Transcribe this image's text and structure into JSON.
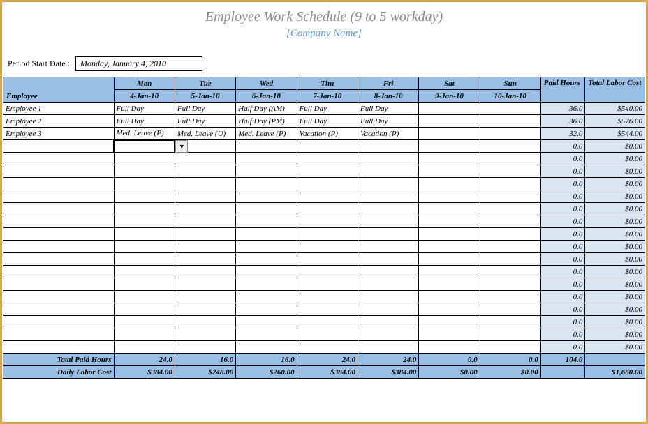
{
  "title": "Employee Work Schedule (9 to 5  workday)",
  "subtitle": "[Company Name]",
  "start_label": "Period Start Date :",
  "start_value": "Monday, January 4, 2010",
  "headers": {
    "employee": "Employee",
    "days": [
      {
        "day": "Mon",
        "date": "4-Jan-10"
      },
      {
        "day": "Tue",
        "date": "5-Jan-10"
      },
      {
        "day": "Wed",
        "date": "6-Jan-10"
      },
      {
        "day": "Thu",
        "date": "7-Jan-10"
      },
      {
        "day": "Fri",
        "date": "8-Jan-10"
      },
      {
        "day": "Sat",
        "date": "9-Jan-10"
      },
      {
        "day": "Sun",
        "date": "10-Jan-10"
      }
    ],
    "paid_hours": "Paid Hours",
    "labor_cost": "Total Labor Cost"
  },
  "rows": [
    {
      "emp": "Employee 1",
      "cells": [
        {
          "t": "Full Day",
          "c": "full-day"
        },
        {
          "t": "Full Day",
          "c": "full-day"
        },
        {
          "t": "Half Day (AM)",
          "c": "half-am"
        },
        {
          "t": "Full Day",
          "c": "full-day"
        },
        {
          "t": "Full Day",
          "c": "full-day"
        },
        {
          "t": "",
          "c": ""
        },
        {
          "t": "",
          "c": ""
        }
      ],
      "hours": "36.0",
      "cost": "$540.00"
    },
    {
      "emp": "Employee 2",
      "cells": [
        {
          "t": "Full Day",
          "c": "full-day"
        },
        {
          "t": "Full Day",
          "c": "full-day"
        },
        {
          "t": "Half Day (PM)",
          "c": "half-pm"
        },
        {
          "t": "Full Day",
          "c": "full-day"
        },
        {
          "t": "Full Day",
          "c": "full-day"
        },
        {
          "t": "",
          "c": ""
        },
        {
          "t": "",
          "c": ""
        }
      ],
      "hours": "36.0",
      "cost": "$576.00"
    },
    {
      "emp": "Employee 3",
      "cells": [
        {
          "t": "Med. Leave (P)",
          "c": "med-p"
        },
        {
          "t": "Med. Leave (U)",
          "c": "med-u"
        },
        {
          "t": "Med. Leave (P)",
          "c": "med-p"
        },
        {
          "t": "Vacation (P)",
          "c": "vac"
        },
        {
          "t": "Vacation (P)",
          "c": "vac"
        },
        {
          "t": "",
          "c": ""
        },
        {
          "t": "",
          "c": ""
        }
      ],
      "hours": "32.0",
      "cost": "$544.00"
    },
    {
      "emp": "",
      "cells": [
        {
          "t": "",
          "c": "",
          "active": true
        },
        {
          "t": "",
          "c": ""
        },
        {
          "t": "",
          "c": ""
        },
        {
          "t": "",
          "c": ""
        },
        {
          "t": "",
          "c": ""
        },
        {
          "t": "",
          "c": ""
        },
        {
          "t": "",
          "c": ""
        }
      ],
      "hours": "0.0",
      "cost": "$0.00"
    },
    {
      "emp": "",
      "cells": [
        {
          "t": "",
          "c": ""
        },
        {
          "t": "",
          "c": ""
        },
        {
          "t": "",
          "c": ""
        },
        {
          "t": "",
          "c": ""
        },
        {
          "t": "",
          "c": ""
        },
        {
          "t": "",
          "c": ""
        },
        {
          "t": "",
          "c": ""
        }
      ],
      "hours": "0.0",
      "cost": "$0.00"
    },
    {
      "emp": "",
      "cells": [
        {
          "t": "",
          "c": ""
        },
        {
          "t": "",
          "c": ""
        },
        {
          "t": "",
          "c": ""
        },
        {
          "t": "",
          "c": ""
        },
        {
          "t": "",
          "c": ""
        },
        {
          "t": "",
          "c": ""
        },
        {
          "t": "",
          "c": ""
        }
      ],
      "hours": "0.0",
      "cost": "$0.00"
    },
    {
      "emp": "",
      "cells": [
        {
          "t": "",
          "c": ""
        },
        {
          "t": "",
          "c": ""
        },
        {
          "t": "",
          "c": ""
        },
        {
          "t": "",
          "c": ""
        },
        {
          "t": "",
          "c": ""
        },
        {
          "t": "",
          "c": ""
        },
        {
          "t": "",
          "c": ""
        }
      ],
      "hours": "0.0",
      "cost": "$0.00"
    },
    {
      "emp": "",
      "cells": [
        {
          "t": "",
          "c": ""
        },
        {
          "t": "",
          "c": ""
        },
        {
          "t": "",
          "c": ""
        },
        {
          "t": "",
          "c": ""
        },
        {
          "t": "",
          "c": ""
        },
        {
          "t": "",
          "c": ""
        },
        {
          "t": "",
          "c": ""
        }
      ],
      "hours": "0.0",
      "cost": "$0.00"
    },
    {
      "emp": "",
      "cells": [
        {
          "t": "",
          "c": ""
        },
        {
          "t": "",
          "c": ""
        },
        {
          "t": "",
          "c": ""
        },
        {
          "t": "",
          "c": ""
        },
        {
          "t": "",
          "c": ""
        },
        {
          "t": "",
          "c": ""
        },
        {
          "t": "",
          "c": ""
        }
      ],
      "hours": "0.0",
      "cost": "$0.00"
    },
    {
      "emp": "",
      "cells": [
        {
          "t": "",
          "c": ""
        },
        {
          "t": "",
          "c": ""
        },
        {
          "t": "",
          "c": ""
        },
        {
          "t": "",
          "c": ""
        },
        {
          "t": "",
          "c": ""
        },
        {
          "t": "",
          "c": ""
        },
        {
          "t": "",
          "c": ""
        }
      ],
      "hours": "0.0",
      "cost": "$0.00"
    },
    {
      "emp": "",
      "cells": [
        {
          "t": "",
          "c": ""
        },
        {
          "t": "",
          "c": ""
        },
        {
          "t": "",
          "c": ""
        },
        {
          "t": "",
          "c": ""
        },
        {
          "t": "",
          "c": ""
        },
        {
          "t": "",
          "c": ""
        },
        {
          "t": "",
          "c": ""
        }
      ],
      "hours": "0.0",
      "cost": "$0.00"
    },
    {
      "emp": "",
      "cells": [
        {
          "t": "",
          "c": ""
        },
        {
          "t": "",
          "c": ""
        },
        {
          "t": "",
          "c": ""
        },
        {
          "t": "",
          "c": ""
        },
        {
          "t": "",
          "c": ""
        },
        {
          "t": "",
          "c": ""
        },
        {
          "t": "",
          "c": ""
        }
      ],
      "hours": "0.0",
      "cost": "$0.00"
    },
    {
      "emp": "",
      "cells": [
        {
          "t": "",
          "c": ""
        },
        {
          "t": "",
          "c": ""
        },
        {
          "t": "",
          "c": ""
        },
        {
          "t": "",
          "c": ""
        },
        {
          "t": "",
          "c": ""
        },
        {
          "t": "",
          "c": ""
        },
        {
          "t": "",
          "c": ""
        }
      ],
      "hours": "0.0",
      "cost": "$0.00"
    },
    {
      "emp": "",
      "cells": [
        {
          "t": "",
          "c": ""
        },
        {
          "t": "",
          "c": ""
        },
        {
          "t": "",
          "c": ""
        },
        {
          "t": "",
          "c": ""
        },
        {
          "t": "",
          "c": ""
        },
        {
          "t": "",
          "c": ""
        },
        {
          "t": "",
          "c": ""
        }
      ],
      "hours": "0.0",
      "cost": "$0.00"
    },
    {
      "emp": "",
      "cells": [
        {
          "t": "",
          "c": ""
        },
        {
          "t": "",
          "c": ""
        },
        {
          "t": "",
          "c": ""
        },
        {
          "t": "",
          "c": ""
        },
        {
          "t": "",
          "c": ""
        },
        {
          "t": "",
          "c": ""
        },
        {
          "t": "",
          "c": ""
        }
      ],
      "hours": "0.0",
      "cost": "$0.00"
    },
    {
      "emp": "",
      "cells": [
        {
          "t": "",
          "c": ""
        },
        {
          "t": "",
          "c": ""
        },
        {
          "t": "",
          "c": ""
        },
        {
          "t": "",
          "c": ""
        },
        {
          "t": "",
          "c": ""
        },
        {
          "t": "",
          "c": ""
        },
        {
          "t": "",
          "c": ""
        }
      ],
      "hours": "0.0",
      "cost": "$0.00"
    },
    {
      "emp": "",
      "cells": [
        {
          "t": "",
          "c": ""
        },
        {
          "t": "",
          "c": ""
        },
        {
          "t": "",
          "c": ""
        },
        {
          "t": "",
          "c": ""
        },
        {
          "t": "",
          "c": ""
        },
        {
          "t": "",
          "c": ""
        },
        {
          "t": "",
          "c": ""
        }
      ],
      "hours": "0.0",
      "cost": "$0.00"
    },
    {
      "emp": "",
      "cells": [
        {
          "t": "",
          "c": ""
        },
        {
          "t": "",
          "c": ""
        },
        {
          "t": "",
          "c": ""
        },
        {
          "t": "",
          "c": ""
        },
        {
          "t": "",
          "c": ""
        },
        {
          "t": "",
          "c": ""
        },
        {
          "t": "",
          "c": ""
        }
      ],
      "hours": "0.0",
      "cost": "$0.00"
    },
    {
      "emp": "",
      "cells": [
        {
          "t": "",
          "c": ""
        },
        {
          "t": "",
          "c": ""
        },
        {
          "t": "",
          "c": ""
        },
        {
          "t": "",
          "c": ""
        },
        {
          "t": "",
          "c": ""
        },
        {
          "t": "",
          "c": ""
        },
        {
          "t": "",
          "c": ""
        }
      ],
      "hours": "0.0",
      "cost": "$0.00"
    },
    {
      "emp": "",
      "cells": [
        {
          "t": "",
          "c": ""
        },
        {
          "t": "",
          "c": ""
        },
        {
          "t": "",
          "c": ""
        },
        {
          "t": "",
          "c": ""
        },
        {
          "t": "",
          "c": ""
        },
        {
          "t": "",
          "c": ""
        },
        {
          "t": "",
          "c": ""
        }
      ],
      "hours": "0.0",
      "cost": "$0.00"
    }
  ],
  "totals": {
    "paid_label": "Total Paid Hours",
    "paid": [
      "24.0",
      "16.0",
      "16.0",
      "24.0",
      "24.0",
      "0.0",
      "0.0"
    ],
    "paid_sum": "104.0",
    "cost_label": "Daily Labor Cost",
    "cost": [
      "$384.00",
      "$248.00",
      "$260.00",
      "$384.00",
      "$384.00",
      "$0.00",
      "$0.00"
    ],
    "cost_sum": "$1,660.00"
  },
  "dropdown_glyph": "▼"
}
